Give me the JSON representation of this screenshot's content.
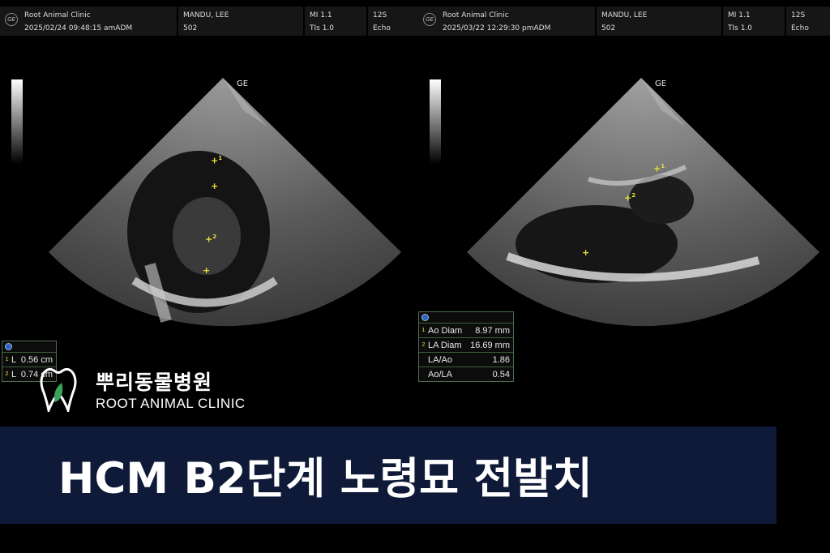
{
  "left_panel": {
    "header": {
      "clinic": "Root Animal Clinic",
      "datetime": "2025/02/24  09:48:15 amADM",
      "patient": "MANDU, LEE",
      "id": "502",
      "mi": "MI 1.1",
      "tis": "TIs 1.0",
      "probe": "12S",
      "mode": "Echo"
    },
    "scan_tag": "GE",
    "measurements": [
      {
        "idx": "1",
        "label": "L",
        "value": "0.56 cm"
      },
      {
        "idx": "2",
        "label": "L",
        "value": "0.74 cm"
      }
    ]
  },
  "right_panel": {
    "header": {
      "clinic": "Root Animal Clinic",
      "datetime": "2025/03/22  12:29:30 pmADM",
      "patient": "MANDU, LEE",
      "id": "502",
      "mi": "MI 1.1",
      "tis": "TIs 1.0",
      "probe": "12S",
      "mode": "Echo"
    },
    "scan_tag": "GE",
    "measurements": [
      {
        "idx": "1",
        "label": "Ao Diam",
        "value": "8.97 mm"
      },
      {
        "idx": "2",
        "label": "LA Diam",
        "value": "16.69 mm"
      },
      {
        "idx": "",
        "label": "LA/Ao",
        "value": "1.86"
      },
      {
        "idx": "",
        "label": "Ao/LA",
        "value": "0.54"
      }
    ]
  },
  "clinic": {
    "name_ko": "뿌리동물병원",
    "name_en": "ROOT ANIMAL CLINIC",
    "logo_icon": "tooth-leaf-icon"
  },
  "banner": {
    "title": "HCM B2단계 노령묘 전발치"
  },
  "colors": {
    "banner_bg": "#0f1a38",
    "caliper": "#e8e23a",
    "logo_leaf": "#3aa35a"
  }
}
